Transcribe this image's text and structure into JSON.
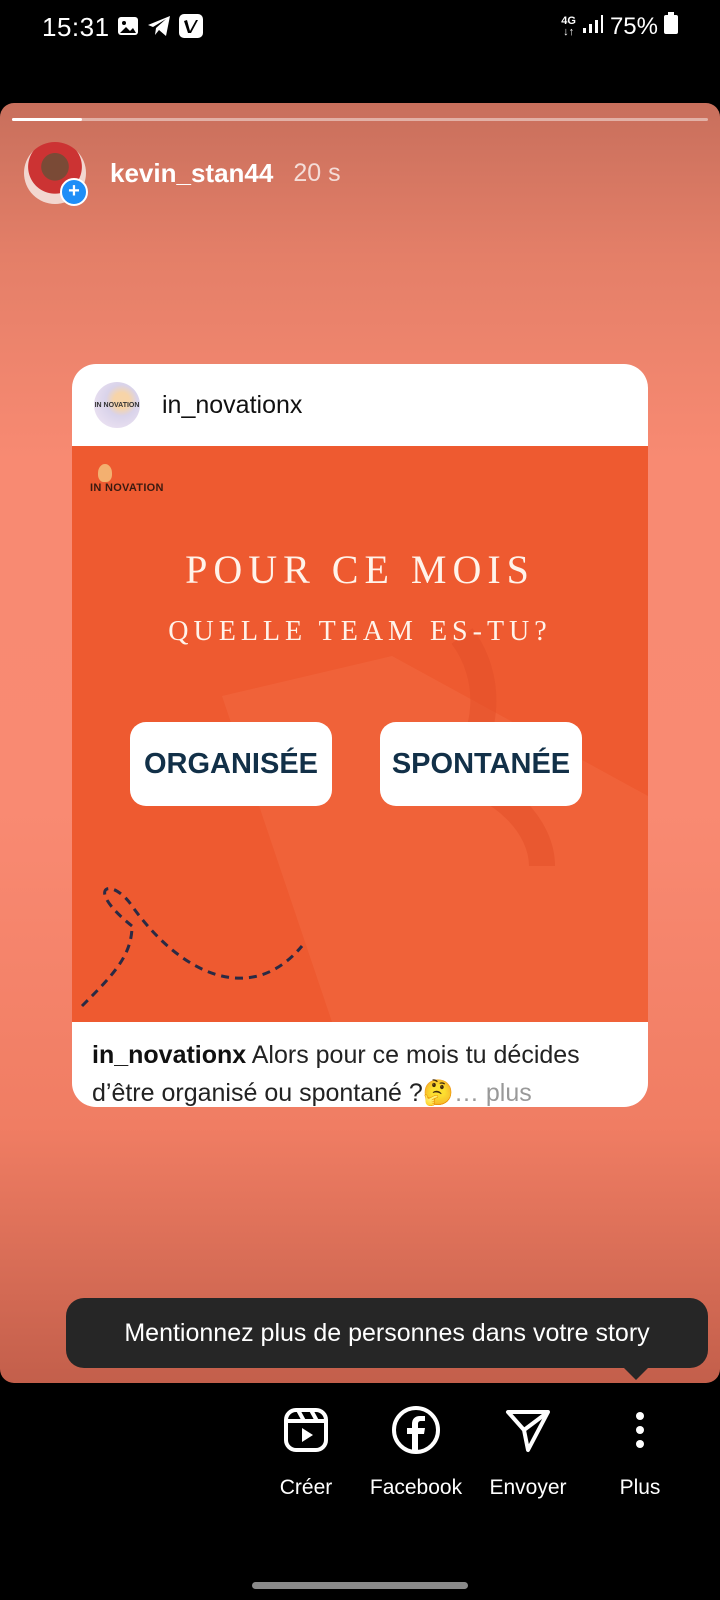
{
  "status_bar": {
    "time": "15:31",
    "network": "4G",
    "battery": "75%"
  },
  "story": {
    "progress": 0.1,
    "username": "kevin_stan44",
    "time_ago": "20 s",
    "add_icon": "+"
  },
  "post": {
    "username": "in_novationx",
    "brand_text": "IN NOVATION",
    "headline_1": "POUR CE MOIS",
    "headline_2": "QUELLE TEAM ES-TU?",
    "option_1": "ORGANISÉE",
    "option_2": "SPONTANÉE",
    "caption_user": "in_novationx",
    "caption_text": " Alors pour ce mois tu décides d’être organisé ou spontané ?🤔",
    "caption_more": "… plus",
    "colors": {
      "image_bg": "#ee5a30",
      "option_text": "#123048"
    }
  },
  "tooltip": {
    "text": "Mentionnez plus de personnes dans votre story"
  },
  "actions": [
    {
      "label": "Créer",
      "icon": "reels-icon"
    },
    {
      "label": "Facebook",
      "icon": "facebook-icon"
    },
    {
      "label": "Envoyer",
      "icon": "send-icon"
    },
    {
      "label": "Plus",
      "icon": "more-vertical-icon"
    }
  ]
}
